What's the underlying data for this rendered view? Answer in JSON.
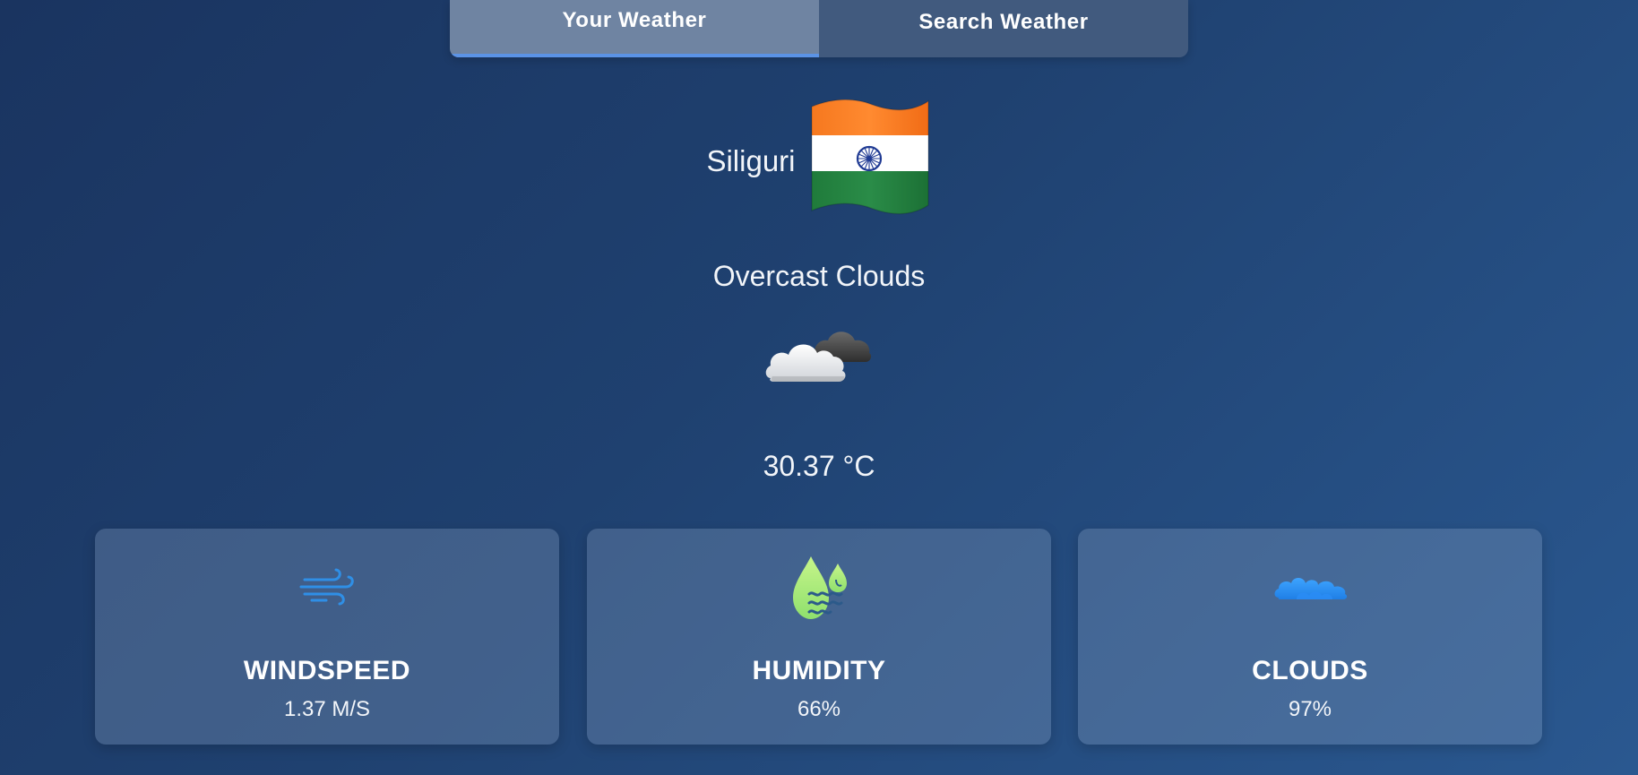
{
  "tabs": [
    {
      "label": "Your Weather",
      "active": true
    },
    {
      "label": "Search Weather",
      "active": false
    }
  ],
  "location": {
    "city": "Siliguri",
    "flag_icon": "india-flag-icon"
  },
  "weather": {
    "description": "Overcast Clouds",
    "icon": "overcast-clouds-icon",
    "temperature": "30.37 °C"
  },
  "cards": [
    {
      "title": "WINDSPEED",
      "value": "1.37 M/S",
      "icon": "wind-icon"
    },
    {
      "title": "HUMIDITY",
      "value": "66%",
      "icon": "humidity-icon"
    },
    {
      "title": "CLOUDS",
      "value": "97%",
      "icon": "clouds-icon"
    }
  ],
  "colors": {
    "active_tab_underline": "#5b93e6",
    "wind_icon": "#2f8fe6",
    "humidity_icon": "#b6ec7e",
    "clouds_icon": "#2a8cf5"
  }
}
